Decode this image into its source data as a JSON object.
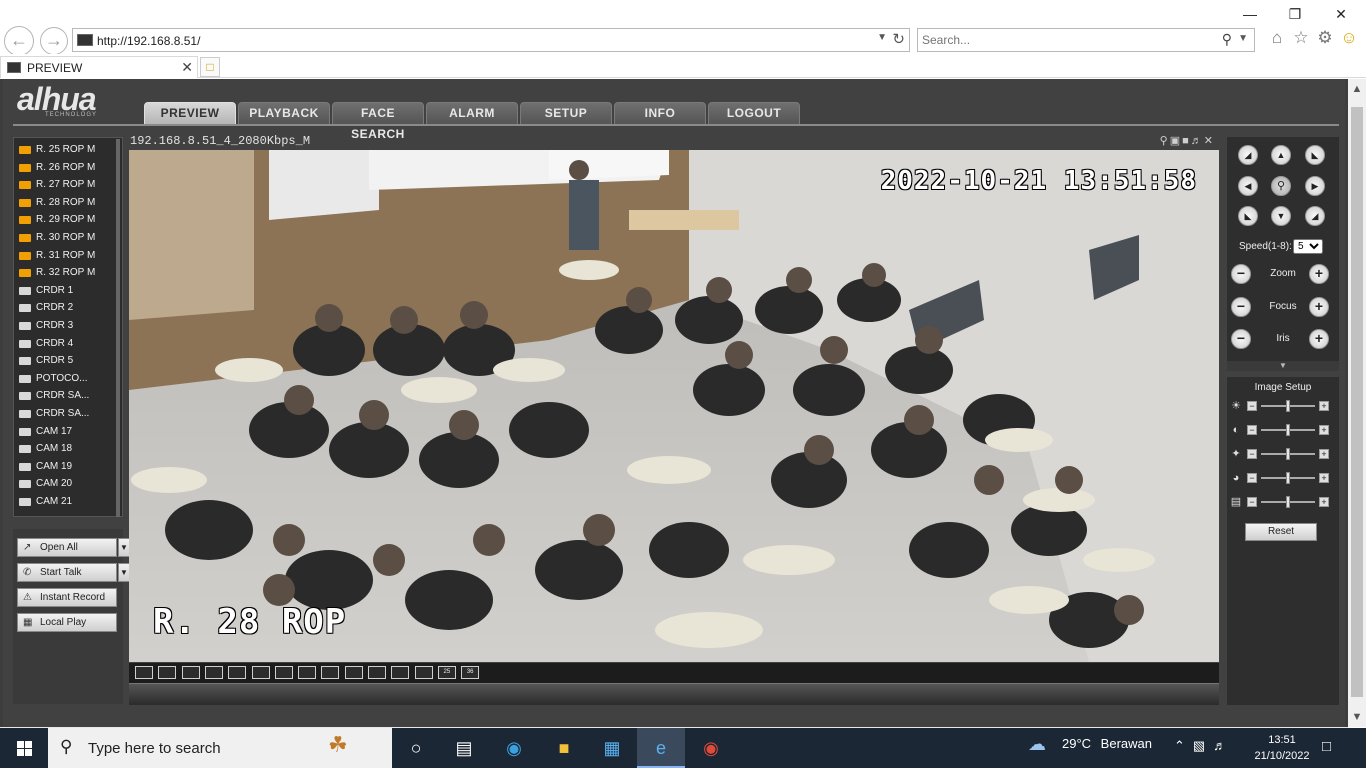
{
  "browser": {
    "url": "http://192.168.8.51/",
    "search_placeholder": "Search...",
    "tab_title": "PREVIEW"
  },
  "app": {
    "brand": "alhua",
    "brand_sub": "TECHNOLOGY",
    "nav": [
      {
        "label": "PREVIEW",
        "active": true
      },
      {
        "label": "PLAYBACK",
        "active": false
      },
      {
        "label": "FACE SEARCH",
        "active": false
      },
      {
        "label": "ALARM",
        "active": false
      },
      {
        "label": "SETUP",
        "active": false
      },
      {
        "label": "INFO",
        "active": false
      },
      {
        "label": "LOGOUT",
        "active": false
      }
    ],
    "channels": [
      {
        "label": "R. 25 ROP   M",
        "active": true
      },
      {
        "label": "R. 26 ROP   M",
        "active": true
      },
      {
        "label": "R. 27 ROP   M",
        "active": true
      },
      {
        "label": "R. 28 ROP   M",
        "active": true
      },
      {
        "label": "R. 29 ROP   M",
        "active": true
      },
      {
        "label": "R. 30 ROP   M",
        "active": true
      },
      {
        "label": "R. 31 ROP   M",
        "active": true
      },
      {
        "label": "R. 32 ROP   M",
        "active": true
      },
      {
        "label": "CRDR 1",
        "active": false
      },
      {
        "label": "CRDR 2",
        "active": false
      },
      {
        "label": "CRDR 3",
        "active": false
      },
      {
        "label": "CRDR 4",
        "active": false
      },
      {
        "label": "CRDR 5",
        "active": false
      },
      {
        "label": "POTOCO...",
        "active": false
      },
      {
        "label": "CRDR SA...",
        "active": false
      },
      {
        "label": "CRDR SA...",
        "active": false
      },
      {
        "label": "CAM 17",
        "active": false
      },
      {
        "label": "CAM 18",
        "active": false
      },
      {
        "label": "CAM 19",
        "active": false
      },
      {
        "label": "CAM 20",
        "active": false
      },
      {
        "label": "CAM 21",
        "active": false
      }
    ],
    "actions": {
      "open_all": "Open All",
      "start_talk": "Start Talk",
      "instant_record": "Instant Record",
      "local_play": "Local Play"
    },
    "video": {
      "stream_label": "192.168.8.51_4_2080Kbps_M",
      "osd_datetime": "2022-10-21  13:51:58",
      "osd_channel": "R. 28 ROP"
    },
    "layout_buttons": [
      "",
      "",
      "",
      "",
      "",
      "",
      "",
      "",
      "",
      "",
      "",
      "",
      "",
      "25",
      "36"
    ],
    "ptz": {
      "speed_label": "Speed(1-8):",
      "speed_value": "5",
      "zoom_label": "Zoom",
      "focus_label": "Focus",
      "iris_label": "Iris"
    },
    "image_setup": {
      "title": "Image Setup",
      "reset_label": "Reset",
      "sliders": [
        {
          "icon": "brightness-icon",
          "value": 0.5
        },
        {
          "icon": "contrast-icon",
          "value": 0.5
        },
        {
          "icon": "saturation-icon",
          "value": 0.5
        },
        {
          "icon": "hue-icon",
          "value": 0.5
        },
        {
          "icon": "sharpness-icon",
          "value": 0.5
        }
      ]
    }
  },
  "taskbar": {
    "search_text": "Type here to search",
    "weather_temp": "29°C",
    "weather_desc": "Berawan",
    "time": "13:51",
    "date": "21/10/2022"
  }
}
